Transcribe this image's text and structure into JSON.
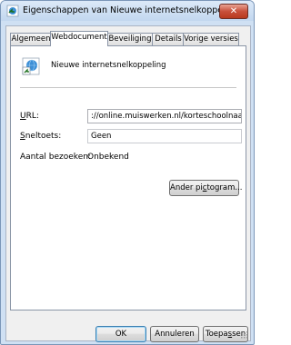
{
  "window": {
    "title": "Eigenschappen van Nieuwe internetsnelkoppeling",
    "close_label": "✕"
  },
  "tabs": [
    {
      "label": "Algemeen"
    },
    {
      "label": "Webdocument"
    },
    {
      "label": "Beveiliging"
    },
    {
      "label": "Details"
    },
    {
      "label": "Vorige versies"
    }
  ],
  "active_tab": "Webdocument",
  "shortcut": {
    "name": "Nieuwe internetsnelkoppeling"
  },
  "fields": {
    "url_label": "URL:",
    "url_value": "://online.muiswerken.nl/korteschoolnaam",
    "hotkey_label": "Sneltoets:",
    "hotkey_value": "Geen",
    "visits_label": "Aantal bezoeken:",
    "visits_value": "Onbekend"
  },
  "buttons": {
    "change_icon": "Ander pictogram...",
    "ok": "OK",
    "cancel": "Annuleren",
    "apply": "Toepassen"
  },
  "colors": {
    "title_bar": "#c2d7ef",
    "close_button": "#c8503b"
  }
}
